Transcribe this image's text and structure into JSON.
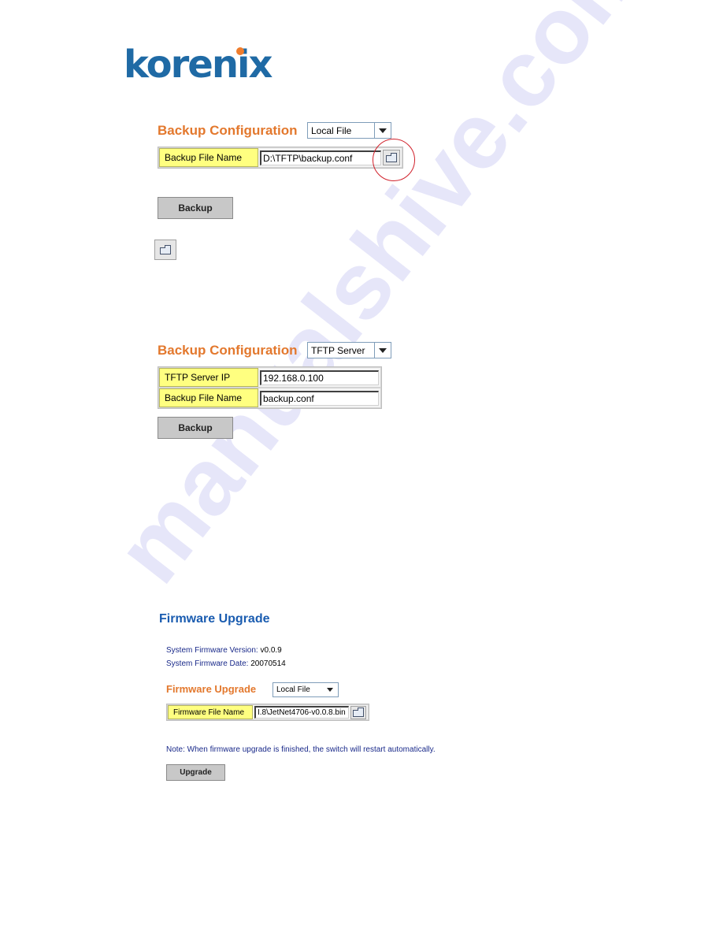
{
  "logo": {
    "text": "korenix",
    "dot_color": "#ef7d2d",
    "text_color": "#1f6aa5"
  },
  "backup_local": {
    "heading": "Backup Configuration",
    "mode_select": "Local File",
    "file_label": "Backup File Name",
    "file_value": "D:\\TFTP\\backup.conf",
    "browse_icon": "folder-icon",
    "button": "Backup"
  },
  "standalone_browse_icon": "folder-icon",
  "backup_tftp": {
    "heading": "Backup Configuration",
    "mode_select": "TFTP Server",
    "rows": [
      {
        "label": "TFTP Server IP",
        "value": "192.168.0.100"
      },
      {
        "label": "Backup File Name",
        "value": "backup.conf"
      }
    ],
    "button": "Backup"
  },
  "firmware": {
    "page_title": "Firmware Upgrade",
    "version_label": "System Firmware Version:",
    "version_value": "v0.0.9",
    "date_label": "System Firmware Date:",
    "date_value": "20070514",
    "heading": "Firmware Upgrade",
    "mode_select": "Local File",
    "file_label": "Firmware File Name",
    "file_value": "I.8\\JetNet4706-v0.0.8.bin",
    "note": "Note: When firmware upgrade is finished, the switch will restart automatically.",
    "button": "Upgrade"
  },
  "watermark": "manualshive.com"
}
